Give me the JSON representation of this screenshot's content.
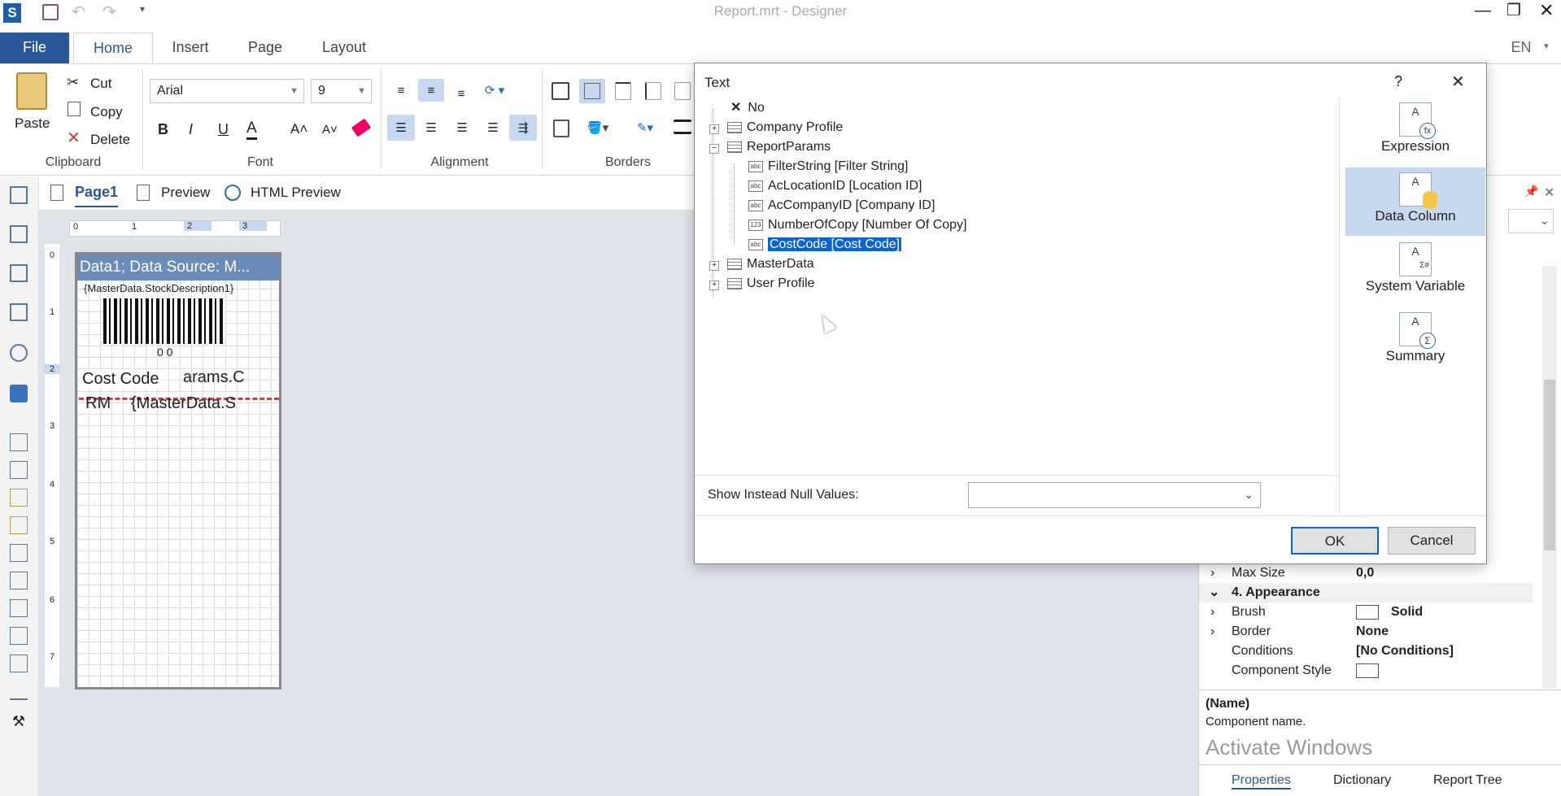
{
  "titlebar": {
    "title": "Report.mrt - Designer",
    "lang": "EN"
  },
  "menu": {
    "file": "File",
    "home": "Home",
    "insert": "Insert",
    "page": "Page",
    "layout": "Layout"
  },
  "clipboard": {
    "paste": "Paste",
    "cut": "Cut",
    "copy": "Copy",
    "delete": "Delete",
    "label": "Clipboard"
  },
  "font": {
    "family": "Arial",
    "size": "9",
    "label": "Font",
    "bold": "B",
    "italic": "I",
    "underline": "U",
    "color": "A"
  },
  "alignment": {
    "label": "Alignment"
  },
  "borders": {
    "label": "Borders"
  },
  "viewtabs": {
    "page1": "Page1",
    "preview": "Preview",
    "html_preview": "HTML Preview"
  },
  "ruler": {
    "h": [
      "0",
      "1",
      "2",
      "3"
    ],
    "v": [
      "0",
      "1",
      "2",
      "3",
      "4",
      "5",
      "6",
      "7"
    ]
  },
  "report": {
    "band_title": "Data1; Data Source: M...",
    "stock_desc": "{MasterData.StockDescription1}",
    "barcode_text": "0 0",
    "cost_code": "Cost Code",
    "params_c": "arams.C",
    "rm": "RM",
    "master_s": "{MasterData.S"
  },
  "dialog": {
    "title": "Text",
    "help": "?",
    "close": "✕",
    "tree": [
      {
        "label": "No",
        "icon": "x"
      },
      {
        "label": "Company Profile",
        "icon": "table"
      },
      {
        "label": "ReportParams",
        "icon": "table"
      },
      {
        "label": "FilterString [Filter String]",
        "icon": "abc"
      },
      {
        "label": "AcLocationID [Location ID]",
        "icon": "abc"
      },
      {
        "label": "AcCompanyID [Company ID]",
        "icon": "abc"
      },
      {
        "label": "NumberOfCopy [Number Of Copy]",
        "icon": "123"
      },
      {
        "label": "CostCode [Cost Code]",
        "icon": "abc"
      },
      {
        "label": "MasterData",
        "icon": "table"
      },
      {
        "label": "User Profile",
        "icon": "table"
      }
    ],
    "side": {
      "expression": "Expression",
      "data_column": "Data Column",
      "system_variable": "System Variable",
      "summary": "Summary"
    },
    "null_label": "Show Instead Null Values:",
    "null_value": "",
    "ok": "OK",
    "cancel": "Cancel"
  },
  "properties": {
    "rows": [
      {
        "key": "Max Size",
        "value": "0,0"
      },
      {
        "key": "4. Appearance",
        "value": ""
      },
      {
        "key": "Brush",
        "value": "Solid"
      },
      {
        "key": "Border",
        "value": "None"
      },
      {
        "key": "Conditions",
        "value": "[No Conditions]"
      },
      {
        "key": "Component Style",
        "value": ""
      }
    ],
    "desc_title": "(Name)",
    "desc_text": "Component name.",
    "watermark": "Activate Windows",
    "tabs": {
      "properties": "Properties",
      "dictionary": "Dictionary",
      "report_tree": "Report Tree"
    }
  },
  "colors": {
    "accent": "#2b579a",
    "selection": "#0a64d6",
    "band": "#6b8cb8"
  }
}
